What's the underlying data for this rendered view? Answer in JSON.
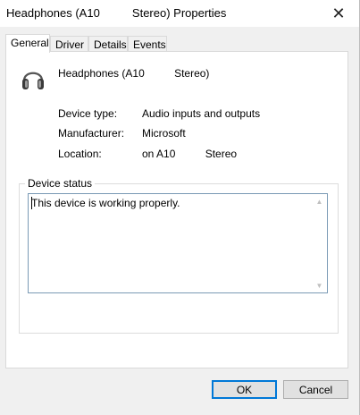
{
  "window": {
    "title": "Headphones (A10          Stereo) Properties"
  },
  "tabs": [
    {
      "label": "General",
      "active": true
    },
    {
      "label": "Driver"
    },
    {
      "label": "Details"
    },
    {
      "label": "Events"
    }
  ],
  "device": {
    "name": "Headphones (A10          Stereo)",
    "icon": "headphones-icon"
  },
  "properties": [
    {
      "label": "Device type:",
      "value": "Audio inputs and outputs"
    },
    {
      "label": "Manufacturer:",
      "value": "Microsoft"
    },
    {
      "label": "Location:",
      "value": "on A10          Stereo"
    }
  ],
  "status": {
    "legend": "Device status",
    "text": "This device is working properly."
  },
  "buttons": {
    "ok": "OK",
    "cancel": "Cancel"
  },
  "colors": {
    "accent": "#0078d7",
    "field_border": "#7a9ab5"
  }
}
